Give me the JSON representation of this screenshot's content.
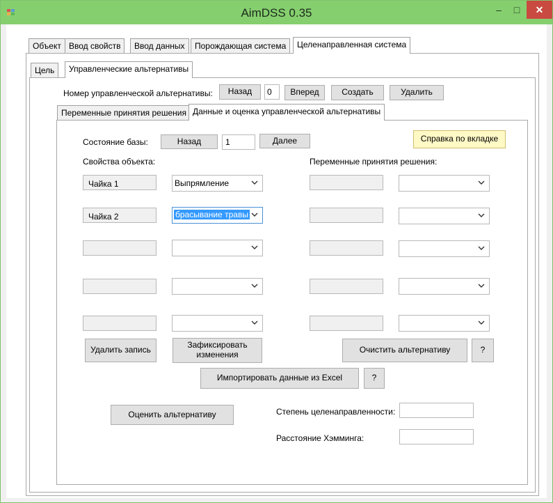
{
  "window": {
    "title": "AimDSS 0.35",
    "minimize": "–",
    "maximize": "□",
    "close": "✕"
  },
  "main_tabs": [
    "Объект",
    "Ввод свойств",
    "Ввод данных",
    "Порождающая система",
    "Целенаправленная система"
  ],
  "sub_tabs": [
    "Цель",
    "Управленческие альтернативы"
  ],
  "alternative": {
    "label": "Номер управленческой альтернативы:",
    "back": "Назад",
    "number": "0",
    "forward": "Вперед",
    "create": "Создать",
    "delete": "Удалить"
  },
  "inner_tabs": [
    "Переменные принятия решения",
    "Данные и оценка управленческой альтернативы"
  ],
  "db_state": {
    "label": "Состояние базы:",
    "back": "Назад",
    "value": "1",
    "next": "Далее"
  },
  "help_button": "Справка по вкладке",
  "object_props_label": "Свойства объекта:",
  "decision_vars_label": "Переменные принятия решения:",
  "rows": [
    {
      "prop": "Чайка 1",
      "value": "Выпрямление",
      "selected": false
    },
    {
      "prop": "Чайка 2",
      "value": "брасывание травы",
      "selected": true
    },
    {
      "prop": "",
      "value": "",
      "selected": false
    },
    {
      "prop": "",
      "value": "",
      "selected": false
    },
    {
      "prop": "",
      "value": "",
      "selected": false
    }
  ],
  "buttons": {
    "delete_record": "Удалить запись",
    "fix_changes_line1": "Зафиксировать",
    "fix_changes_line2": "изменения",
    "clear_alternative": "Очистить альтернативу",
    "question": "?",
    "import_excel": "Импортировать данные из Excel",
    "evaluate": "Оценить альтернативу"
  },
  "metrics": {
    "purposefulness_label": "Степень целенаправленности:",
    "hamming_label": "Расстояние Хэмминга:",
    "purposefulness_value": "",
    "hamming_value": ""
  },
  "colors": {
    "titlebar": "#86cf6f",
    "close": "#c94a40",
    "help_bg": "#fff9c6",
    "selection": "#3399ff"
  }
}
